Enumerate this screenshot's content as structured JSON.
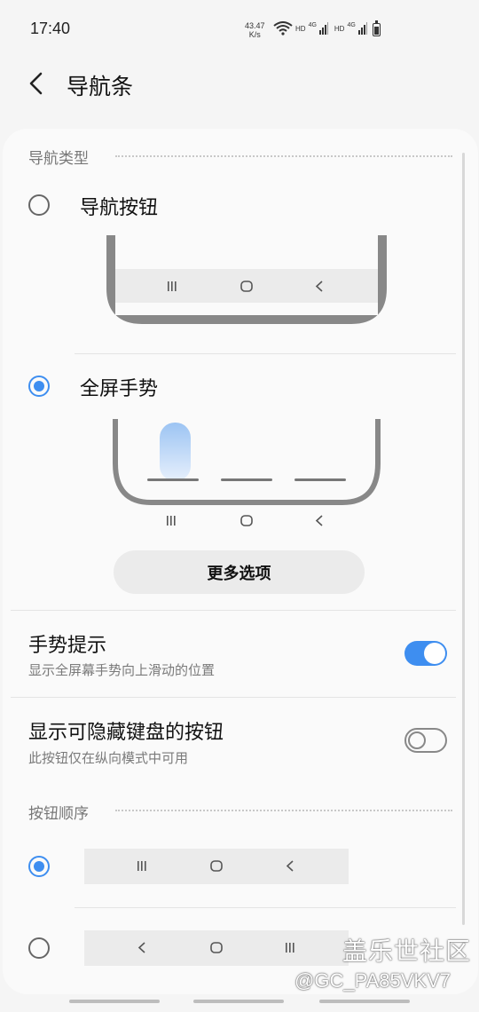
{
  "status_bar": {
    "time": "17:40",
    "speed_value": "43.47",
    "speed_unit": "K/s",
    "network_1": "HD",
    "network_1_gen": "4G",
    "network_2": "HD",
    "network_2_gen": "4G",
    "icons": [
      "wifi-icon",
      "signal-icon",
      "battery-icon"
    ]
  },
  "header": {
    "title": "导航条",
    "back_icon": "chevron-left-icon"
  },
  "nav_type": {
    "section_title": "导航类型",
    "options": [
      {
        "label": "导航按钮",
        "selected": false
      },
      {
        "label": "全屏手势",
        "selected": true
      }
    ],
    "more_button": "更多选项"
  },
  "gesture_hint": {
    "title": "手势提示",
    "subtitle": "显示全屏幕手势向上滑动的位置",
    "enabled": true
  },
  "hide_keyboard_button": {
    "title": "显示可隐藏键盘的按钮",
    "subtitle": "此按钮仅在纵向模式中可用",
    "enabled": false
  },
  "button_order": {
    "section_title": "按钮顺序",
    "options": [
      {
        "order": [
          "recents",
          "home",
          "back"
        ],
        "selected": true
      },
      {
        "order": [
          "back",
          "home",
          "recents"
        ],
        "selected": false
      }
    ]
  },
  "watermark": {
    "line1": "盖乐世社区",
    "line2": "@GC_PA85VKV7"
  },
  "colors": {
    "accent": "#3e8ef0",
    "background": "#f5f5f5",
    "card": "#fafafa"
  }
}
